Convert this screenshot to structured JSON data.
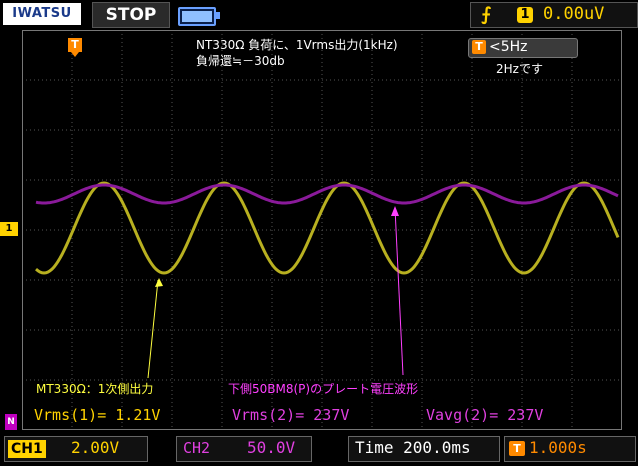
{
  "header": {
    "brand": "IWATSU",
    "run_state": "STOP",
    "trigger": {
      "edge_icon": "rising-edge-icon",
      "channel": "1",
      "level": "0.00uV"
    }
  },
  "screen": {
    "trigger_marker": "T",
    "filter": {
      "icon": "T",
      "value": "<5Hz"
    },
    "ch1_ground_marker": "1",
    "ch2_ground_marker": "N"
  },
  "annotations": {
    "top_line1": "NT330Ω 負荷に、1Vrms出力(1kHz)",
    "top_line2": "負帰還≒－30db",
    "filter_note": "2Hzです",
    "ch1_note": "MT330Ω：1次側出力",
    "ch2_note": "下側50BM8(P)のプレート電圧波形",
    "ch1_color": "#ffff40",
    "ch2_color": "#ff40ff"
  },
  "measurements": {
    "vrms1": "Vrms(1)= 1.21V",
    "vrms2": "Vrms(2)= 237V",
    "vavg2": "Vavg(2)= 237V"
  },
  "footer": {
    "ch1_label": "CH1",
    "ch1_scale": "2.00V",
    "ch2_label": "CH2",
    "ch2_scale": "50.0V",
    "timebase": "Time 200.0ms",
    "delay": "1.000s"
  },
  "colors": {
    "ch1": "#ffd200",
    "ch2": "#c000c0",
    "trigger": "#ff8a00"
  }
}
